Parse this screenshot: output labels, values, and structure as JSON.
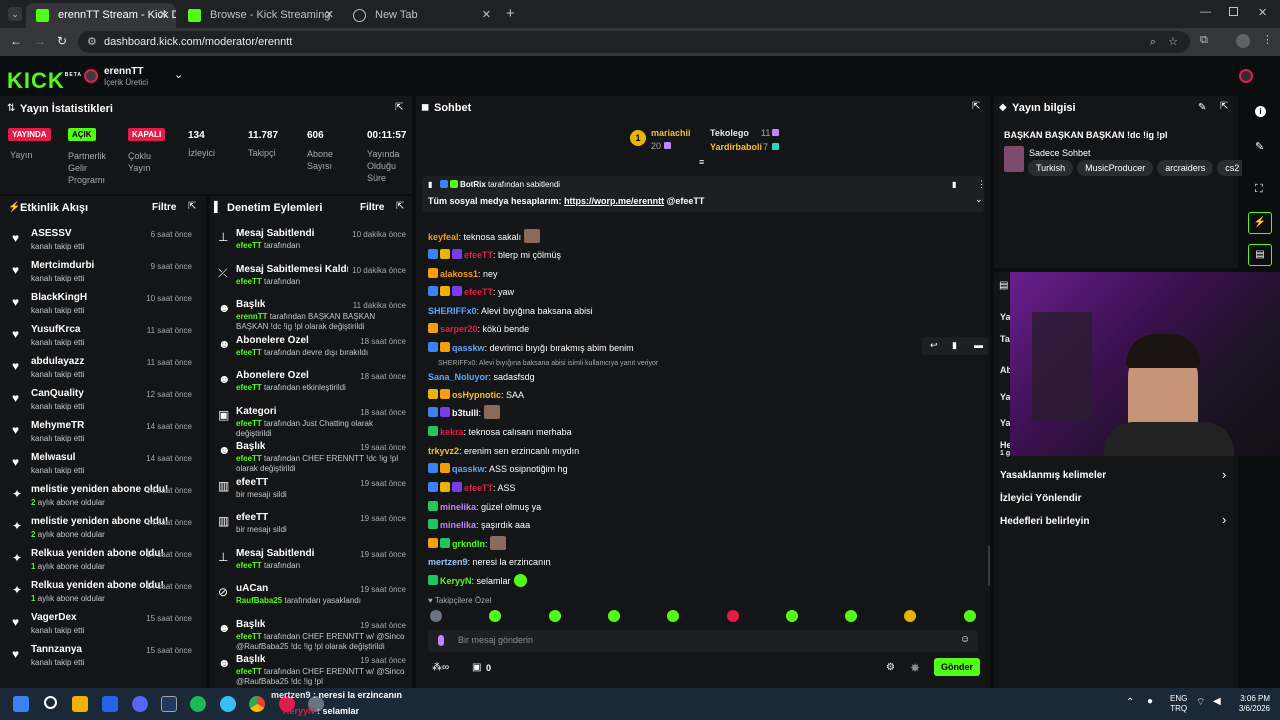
{
  "browser": {
    "tabs": [
      {
        "label": "erennTT Stream - Kick Dashboar",
        "active": true
      },
      {
        "label": "Browse - Kick Streaming",
        "active": false
      },
      {
        "label": "New Tab",
        "active": false
      }
    ],
    "url": "dashboard.kick.com/moderator/erenntt"
  },
  "header": {
    "logo": "KICK",
    "logo_sup": "BETA",
    "channel": "erennTT",
    "role": "İçerik Üretici"
  },
  "stats_panel": {
    "title": "Yayın İstatistikleri",
    "badges": [
      {
        "label": "YAYINDA",
        "caption": "Yayın",
        "color": "#e11d48"
      },
      {
        "label": "AÇIK",
        "caption": "Partnerlik Gelir Programı",
        "color": "#53fc18"
      },
      {
        "label": "KAPALI",
        "caption": "Çoklu Yayın",
        "color": "#e11d48"
      }
    ],
    "numbers": [
      {
        "value": "134",
        "caption": "İzleyici"
      },
      {
        "value": "11.787",
        "caption": "Takipçi"
      },
      {
        "value": "606",
        "caption": "Abone Sayısı"
      },
      {
        "value": "00:11:57",
        "caption": "Yayında Olduğu Süre"
      }
    ]
  },
  "activity": {
    "title": "Etkinlik Akışı",
    "filter": "Filtre",
    "items": [
      {
        "icon": "heart",
        "name": "ASESSV",
        "sub": "kanalı takip etti",
        "sub_prefix": "",
        "time": "6 saat önce"
      },
      {
        "icon": "heart",
        "name": "Mertcimdurbi",
        "sub": "kanalı takip etti",
        "sub_prefix": "",
        "time": "9 saat önce"
      },
      {
        "icon": "heart",
        "name": "BlackKingH",
        "sub": "kanalı takip etti",
        "sub_prefix": "",
        "time": "10 saat önce"
      },
      {
        "icon": "heart",
        "name": "YusufKrca",
        "sub": "kanalı takip etti",
        "sub_prefix": "",
        "time": "11 saat önce"
      },
      {
        "icon": "heart",
        "name": "abdulayazz",
        "sub": "kanalı takip etti",
        "sub_prefix": "",
        "time": "11 saat önce"
      },
      {
        "icon": "heart",
        "name": "CanQuality",
        "sub": "kanalı takip etti",
        "sub_prefix": "",
        "time": "12 saat önce"
      },
      {
        "icon": "heart",
        "name": "MehymeTR",
        "sub": "kanalı takip etti",
        "sub_prefix": "",
        "time": "14 saat önce"
      },
      {
        "icon": "heart",
        "name": "Melwasul",
        "sub": "kanalı takip etti",
        "sub_prefix": "",
        "time": "14 saat önce"
      },
      {
        "icon": "star",
        "name": "melistie yeniden abone oldu!",
        "sub": "aylık abone oldular",
        "sub_prefix": "2",
        "time": "14 saat önce"
      },
      {
        "icon": "star",
        "name": "melistie yeniden abone oldu!",
        "sub": "aylık abone oldular",
        "sub_prefix": "2",
        "time": "14 saat önce"
      },
      {
        "icon": "star",
        "name": "Relkua yeniden abone oldu!",
        "sub": "aylık abone oldular",
        "sub_prefix": "1",
        "time": "14 saat önce"
      },
      {
        "icon": "star",
        "name": "Relkua yeniden abone oldu!",
        "sub": "aylık abone oldular",
        "sub_prefix": "1",
        "time": "14 saat önce"
      },
      {
        "icon": "heart",
        "name": "VagerDex",
        "sub": "kanalı takip etti",
        "sub_prefix": "",
        "time": "15 saat önce"
      },
      {
        "icon": "heart",
        "name": "Tannzanya",
        "sub": "kanalı takip etti",
        "sub_prefix": "",
        "time": "15 saat önce"
      }
    ]
  },
  "moderation": {
    "title": "Denetim Eylemleri",
    "filter": "Filtre",
    "items": [
      {
        "icon": "pin",
        "name": "Mesaj Sabitlendi",
        "actor": "efeeTT",
        "sub": "tarafından",
        "time": "10 dakika önce"
      },
      {
        "icon": "unpin",
        "name": "Mesaj Sabitlemesi Kaldırıldı",
        "actor": "efeeTT",
        "sub": "tarafından",
        "time": "10 dakika önce"
      },
      {
        "icon": "user",
        "name": "Başlık",
        "actor": "erennTT",
        "sub": "tarafından BAŞKAN BAŞKAN BAŞKAN !dc !ig !pl olarak değiştirildi",
        "time": "11 dakika önce"
      },
      {
        "icon": "user",
        "name": "Abonelere Özel",
        "actor": "efeeTT",
        "sub": "tarafından devre dışı bırakıldı",
        "time": "18 saat önce"
      },
      {
        "icon": "user",
        "name": "Abonelere Özel",
        "actor": "efeeTT",
        "sub": "tarafından etkinleştirildi",
        "time": "18 saat önce"
      },
      {
        "icon": "folder",
        "name": "Kategori",
        "actor": "efeeTT",
        "sub": "tarafından Just Chatting olarak değiştirildi",
        "time": "18 saat önce"
      },
      {
        "icon": "user",
        "name": "Başlık",
        "actor": "efeeTT",
        "sub": "tarafından CHEF ERENNTT !dc !ig !pl olarak değiştirildi",
        "time": "19 saat önce"
      },
      {
        "icon": "trash",
        "name": "efeeTT",
        "actor": "",
        "sub": "bir mesajı sildi",
        "time": "19 saat önce"
      },
      {
        "icon": "trash",
        "name": "efeeTT",
        "actor": "",
        "sub": "bir mesajı sildi",
        "time": "19 saat önce"
      },
      {
        "icon": "pin",
        "name": "Mesaj Sabitlendi",
        "actor": "efeeTT",
        "sub": "tarafından",
        "time": "19 saat önce"
      },
      {
        "icon": "ban",
        "name": "uACan",
        "actor": "RaufBaba25",
        "sub": "tarafından yasaklandı",
        "time": "19 saat önce"
      },
      {
        "icon": "user",
        "name": "Başlık",
        "actor": "efeeTT",
        "sub": "tarafından CHEF ERENNTT w/ @Sinco @RaufBaba25 !dc !ig !pl olarak değiştirildi",
        "time": "19 saat önce"
      },
      {
        "icon": "user",
        "name": "Başlık",
        "actor": "efeeTT",
        "sub": "tarafından CHEF ERENNTT w/ @Sinco @RaufBaba25 !dc !ig !pl",
        "time": "19 saat önce"
      }
    ]
  },
  "chat": {
    "title": "Sohbet",
    "top_gifters": [
      {
        "name": "mariachii",
        "count": "20"
      },
      {
        "name": "Tekolego",
        "count": "11"
      },
      {
        "name": "Yardirbaboli",
        "count": "7"
      }
    ],
    "pinned": {
      "by": "BotRix",
      "by_suffix": "tarafından sabitlendi",
      "text": "Tüm sosyal medya hesaplarım: ",
      "link": "https://worp.me/erenntt",
      "mention": " @efeeTT"
    },
    "messages": [
      {
        "user": "keyfeal",
        "color": "#f59e0b",
        "text": "teknosa sakalı"
      },
      {
        "user": "efeeTT",
        "color": "#e11d48",
        "text": "blerp mi çölmüş"
      },
      {
        "user": "alakoss1",
        "color": "#f59e0b",
        "text": "ney"
      },
      {
        "user": "efeeTT",
        "color": "#e11d48",
        "text": "yaw"
      },
      {
        "user": "SHERIFFx0",
        "color": "#60a5fa",
        "text": "Alevi bıyığına baksana abisi"
      },
      {
        "user": "sarper20",
        "color": "#e11d48",
        "text": "kökü bende"
      },
      {
        "user": "qasskw",
        "color": "#60a5fa",
        "text": "devrimci bıyığı bırakmış abim benim"
      },
      {
        "user": "Sana_Noluyor",
        "color": "#60a5fa",
        "text": "sadasfsdg"
      },
      {
        "user": "osHypnotic",
        "color": "#fbbf24",
        "text": "SAA"
      },
      {
        "user": "b3tulll",
        "color": "#ffffff",
        "text": ""
      },
      {
        "user": "kekra",
        "color": "#e11d48",
        "text": "teknosa calısanı merhaba"
      },
      {
        "user": "trkyvz2",
        "color": "#fbbf24",
        "text": "erenim sen erzincanlı mıydın"
      },
      {
        "user": "qasskw",
        "color": "#60a5fa",
        "text": "ASS osipnotiğim hg"
      },
      {
        "user": "efeeTT",
        "color": "#e11d48",
        "text": "ASS"
      },
      {
        "user": "minelika",
        "color": "#c084fc",
        "text": "güzel olmuş ya"
      },
      {
        "user": "minelika",
        "color": "#c084fc",
        "text": "şaşırdık aaa"
      },
      {
        "user": "grkndln",
        "color": "#53fc18",
        "text": ""
      },
      {
        "user": "mertzen9",
        "color": "#93c5fd",
        "text": "neresi la erzincanın"
      },
      {
        "user": "KeryyN",
        "color": "#53fc18",
        "text": "selamlar"
      }
    ],
    "reply_note": "SHERIFFx0: Alevi bıyığına baksana abisi isimli kullanıcıya yanıt veriyor",
    "followers_only": "Takipçilere Özel",
    "input_placeholder": "Bir mesaj gönderin",
    "send": "Gönder",
    "points": "0"
  },
  "stream_info": {
    "title": "Yayın bilgisi",
    "stream_title": "BAŞKAN BAŞKAN BAŞKAN !dc !ig !pl",
    "category": "Sadece Sohbet",
    "tags": [
      "Turkish",
      "MusicProducer",
      "arcraiders",
      "cs2"
    ]
  },
  "settings": {
    "items": [
      "Yasaklanmış kelimeler",
      "İzleyici Yönlendir",
      "Hedefleri belirleyin"
    ],
    "partial": [
      "Ya",
      "Tal",
      "Ab",
      "Ya",
      "Ya",
      "He",
      "1 gün"
    ]
  },
  "overlay_chat": [
    {
      "user": "mertzen9",
      "text": "neresi la erzincanın"
    },
    {
      "user": "KeryyN",
      "text": "selamlar"
    }
  ],
  "taskbar": {
    "lang": "ENG",
    "lang2": "TRQ",
    "time": "3:06 PM",
    "date": "3/6/2026"
  },
  "colors": {
    "accent": "#53fc18",
    "panel": "#141517",
    "bg": "#0b0d0e"
  }
}
